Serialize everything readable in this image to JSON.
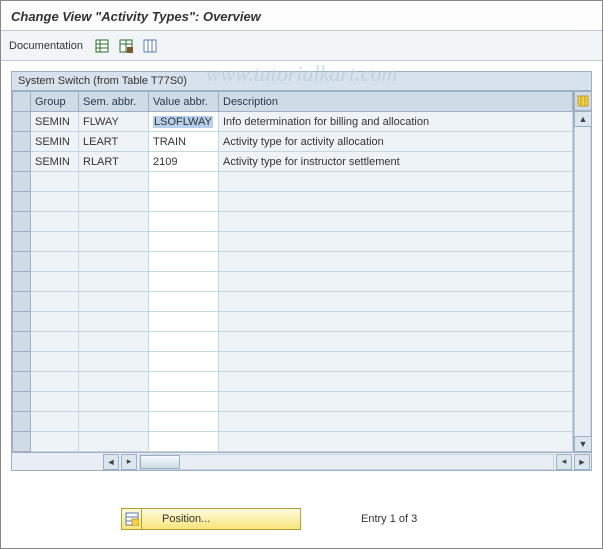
{
  "header": {
    "title": "Change View \"Activity Types\": Overview"
  },
  "toolbar": {
    "documentation_label": "Documentation"
  },
  "watermark": "www.tutorialkart.com",
  "panel": {
    "title": "System Switch (from Table T77S0)",
    "columns": {
      "group": "Group",
      "sem": "Sem. abbr.",
      "val": "Value abbr.",
      "desc": "Description"
    },
    "rows": [
      {
        "group": "SEMIN",
        "sem": "FLWAY",
        "val": "LSOFLWAY",
        "desc": "Info determination for billing and allocation",
        "selected": true
      },
      {
        "group": "SEMIN",
        "sem": "LEART",
        "val": "TRAIN",
        "desc": "Activity type for activity allocation",
        "selected": false
      },
      {
        "group": "SEMIN",
        "sem": "RLART",
        "val": "2109",
        "desc": "Activity type for instructor settlement",
        "selected": false
      }
    ]
  },
  "footer": {
    "position_label": "Position...",
    "entry_label": "Entry 1 of 3"
  }
}
